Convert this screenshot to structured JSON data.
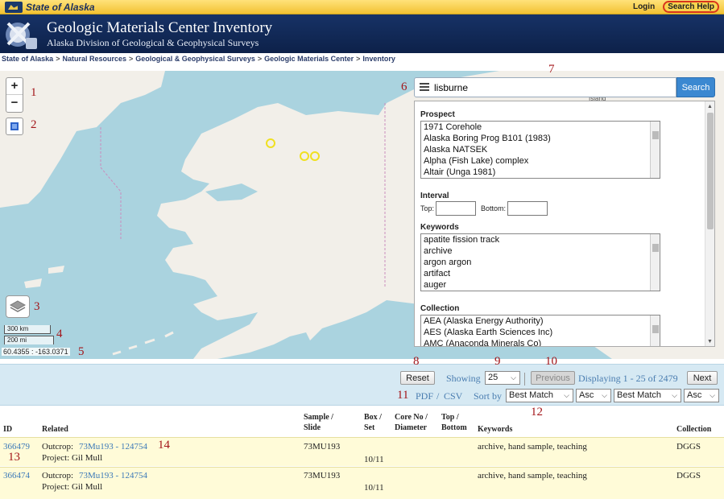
{
  "topbar": {
    "state_logo": "State of Alaska",
    "login": "Login",
    "search_help": "Search Help"
  },
  "header": {
    "title": "Geologic Materials Center Inventory",
    "subtitle": "Alaska Division of Geological & Geophysical Surveys"
  },
  "breadcrumb": [
    "State of Alaska",
    "Natural Resources",
    "Geological & Geophysical Surveys",
    "Geologic Materials Center",
    "Inventory"
  ],
  "breadcrumb_sep": ">",
  "map": {
    "zoom_in": "+",
    "zoom_out": "−",
    "scale_km": "300 km",
    "scale_mi": "200 mi",
    "coords": "60.4355 : -163.0371",
    "water_color": "#aad3df",
    "land_color": "#f2efe9",
    "marker_color": "#f0e020",
    "island_label": "Island"
  },
  "search": {
    "value": "lisburne",
    "button": "Search",
    "prospect_label": "Prospect",
    "prospects": [
      "1971 Corehole",
      "Alaska Boring Prog B101 (1983)",
      "Alaska NATSEK",
      "Alpha (Fish Lake) complex",
      "Altair (Unga 1981)"
    ],
    "interval_label": "Interval",
    "top_label": "Top:",
    "bottom_label": "Bottom:",
    "keywords_label": "Keywords",
    "keywords": [
      "apatite fission track",
      "archive",
      "argon argon",
      "artifact",
      "auger"
    ],
    "collection_label": "Collection",
    "collections": [
      "AEA (Alaska Energy Authority)",
      "AES (Alaska Earth Sciences Inc)",
      "AMC (Anaconda Minerals Co)"
    ]
  },
  "toolbar": {
    "reset": "Reset",
    "showing": "Showing",
    "page_size": "25",
    "previous": "Previous",
    "displaying": "Displaying 1 - 25 of 2479",
    "next": "Next",
    "pdf": "PDF",
    "slash": "/",
    "csv": "CSV",
    "sort_by": "Sort by",
    "sort1": "Best Match",
    "order1": "Asc",
    "sort2": "Best Match",
    "order2": "Asc"
  },
  "table": {
    "headers": {
      "id": "ID",
      "related": "Related",
      "sample_1": "Sample /",
      "sample_2": "Slide",
      "box_1": "Box /",
      "box_2": "Set",
      "core_1": "Core No /",
      "core_2": "Diameter",
      "top_1": "Top /",
      "top_2": "Bottom",
      "keywords": "Keywords",
      "collection": "Collection"
    },
    "rows": [
      {
        "id": "366479",
        "outcrop_label": "Outcrop:",
        "outcrop": "73Mu193 - 124754",
        "project": "Project: Gil Mull",
        "sample": "73MU193",
        "box": "10/11",
        "keywords": "archive, hand sample, teaching",
        "collection": "DGGS"
      },
      {
        "id": "366474",
        "outcrop_label": "Outcrop:",
        "outcrop": "73Mu193 - 124754",
        "project": "Project: Gil Mull",
        "sample": "73MU193",
        "box": "10/11",
        "keywords": "archive, hand sample, teaching",
        "collection": "DGGS"
      }
    ]
  },
  "annotations": [
    "1",
    "2",
    "3",
    "4",
    "5",
    "6",
    "7",
    "8",
    "9",
    "10",
    "11",
    "12",
    "13",
    "14"
  ]
}
